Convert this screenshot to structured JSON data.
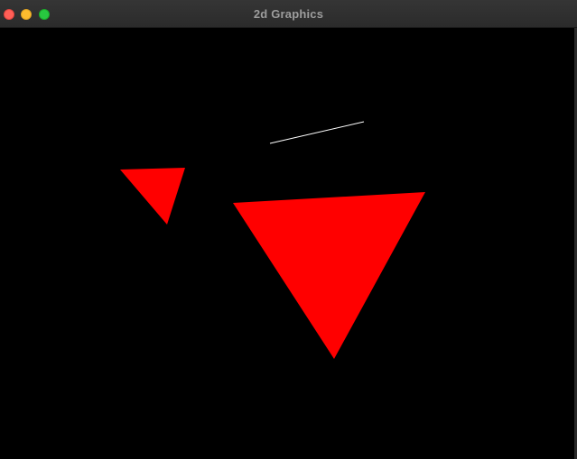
{
  "window": {
    "title": "2d Graphics"
  },
  "colors": {
    "canvas_background": "#000000",
    "shape_fill": "#ff0000",
    "line_stroke": "#ffffff"
  },
  "scene": {
    "shapes": [
      {
        "kind": "triangle",
        "name": "small-triangle",
        "color": "#ff0000"
      },
      {
        "kind": "triangle",
        "name": "large-triangle",
        "color": "#ff0000"
      },
      {
        "kind": "line",
        "name": "white-line",
        "color": "#ffffff"
      }
    ]
  }
}
